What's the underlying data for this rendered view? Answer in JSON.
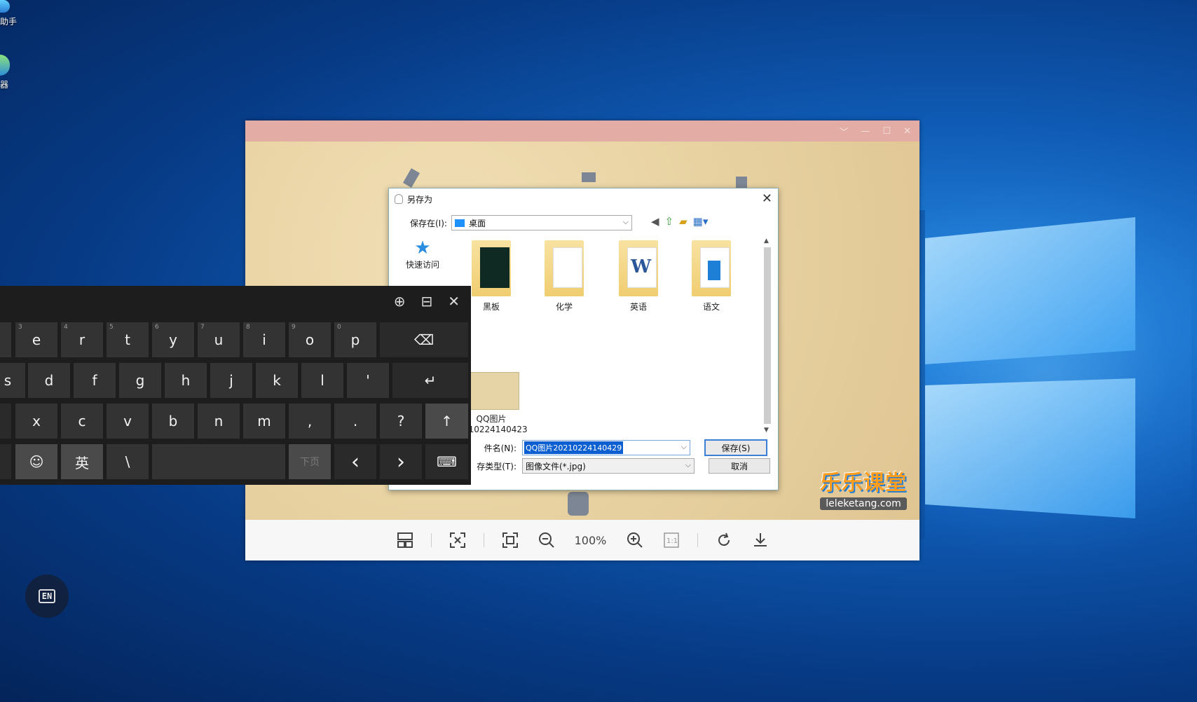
{
  "desktop": {
    "icons": [
      {
        "label": "助手",
        "icon": "app-icon"
      },
      {
        "label": "器",
        "icon": "browser-icon"
      }
    ],
    "lang_badge": "EN"
  },
  "viewer": {
    "title_buttons": [
      "﹀",
      "—",
      "☐",
      "✕"
    ],
    "brand_logo": "乐乐课堂",
    "brand_url": "leleketang.com",
    "toolbar": {
      "zoom_level": "100%",
      "icons": [
        "layout-icon",
        "fit-icon",
        "fullscreen-icon",
        "zoom-out-icon",
        "zoom-in-icon",
        "actual-size-icon",
        "rotate-icon",
        "download-icon"
      ]
    }
  },
  "dialog": {
    "title": "另存为",
    "save_in_label": "保存在(I):",
    "save_in_value": "桌面",
    "places": [
      {
        "label": "快速访问",
        "icon": "star-icon"
      }
    ],
    "files": [
      {
        "label": "黑板",
        "kind": "folder-dark"
      },
      {
        "label": "化学",
        "kind": "folder-doc"
      },
      {
        "label": "英语",
        "kind": "folder-word"
      },
      {
        "label": "语文",
        "kind": "folder-blue"
      },
      {
        "label": "QQ图片",
        "sublabel": "210224140423",
        "kind": "image"
      }
    ],
    "filename_label": "件名(N):",
    "filename_value": "QQ图片20210224140429",
    "filetype_label": "存类型(T):",
    "filetype_value": "图像文件(*.jpg)",
    "save_button": "保存(S)",
    "cancel_button": "取消"
  },
  "keyboard": {
    "row1": [
      {
        "k": "e",
        "n": "3"
      },
      {
        "k": "r",
        "n": "4"
      },
      {
        "k": "t",
        "n": "5"
      },
      {
        "k": "y",
        "n": "6"
      },
      {
        "k": "u",
        "n": "7"
      },
      {
        "k": "i",
        "n": "8"
      },
      {
        "k": "o",
        "n": "9"
      },
      {
        "k": "p",
        "n": "0"
      }
    ],
    "row2": [
      "s",
      "d",
      "f",
      "g",
      "h",
      "j",
      "k",
      "l",
      "'"
    ],
    "row3": [
      "x",
      "c",
      "v",
      "b",
      "n",
      "m",
      ",",
      ".",
      "?"
    ],
    "row4": {
      "lang": "英",
      "backslash": "\\",
      "next_page": "下页"
    },
    "glyphs": {
      "backspace": "⌫",
      "enter": "↵",
      "shift": "↑",
      "emoji": "☺",
      "left": "‹",
      "right": "›",
      "kbd": "⌨",
      "dock": "⊟",
      "move": "⊕",
      "close": "✕"
    }
  }
}
